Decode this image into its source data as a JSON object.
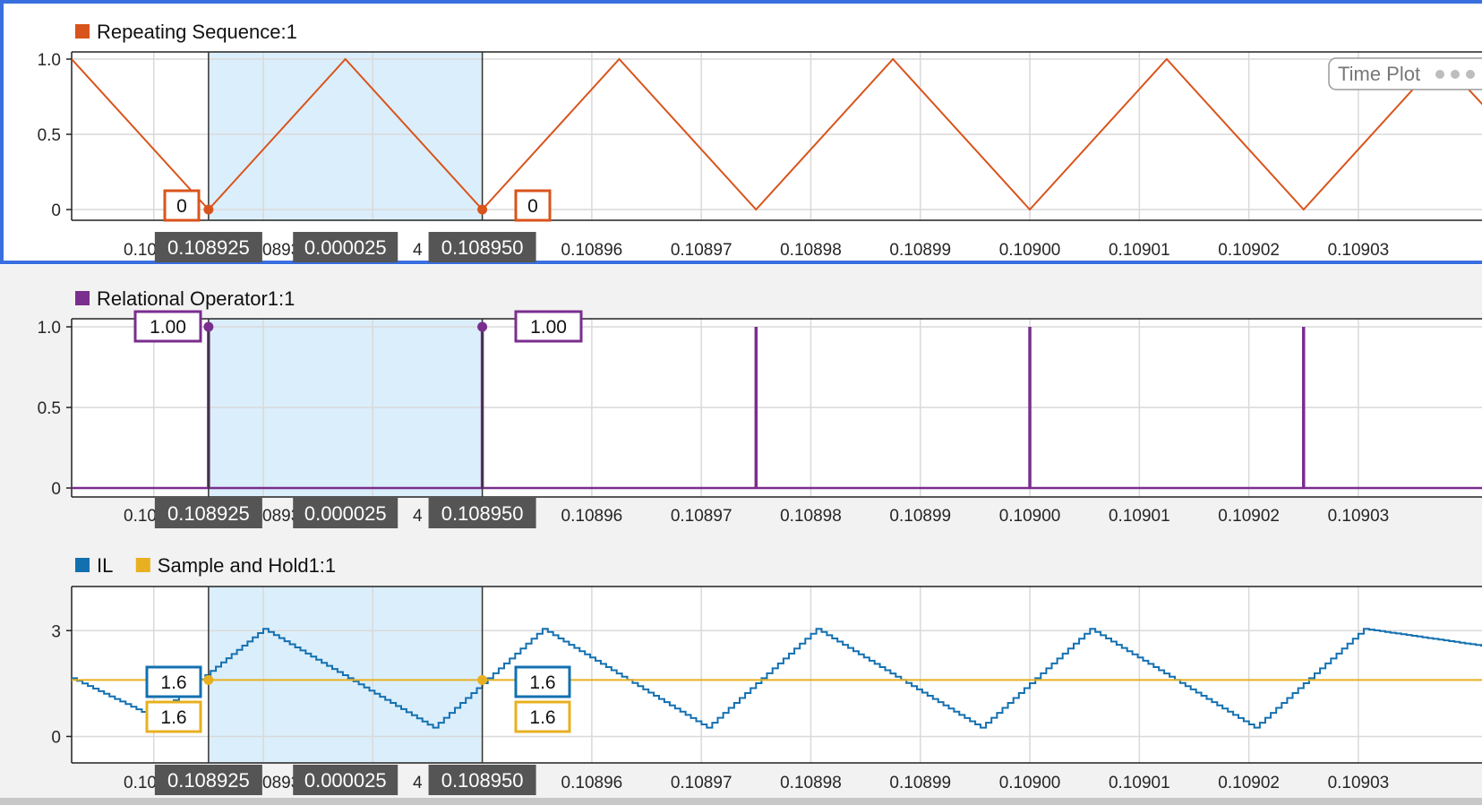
{
  "colors": {
    "repeating": "#d9541c",
    "relational": "#7a2e8e",
    "il": "#1370b0",
    "sample_hold": "#e8b020",
    "selection": "#dbeefb",
    "cursor_label_bg": "#555555",
    "active_border": "#3a6fe0",
    "grid": "#d9d9d9"
  },
  "badge": {
    "label": "Time Plot",
    "icon": "more-dots-icon"
  },
  "x_ticks": [
    "0.10895",
    "0.10896",
    "0.10897",
    "0.10898",
    "0.10899",
    "0.10900",
    "0.10901",
    "0.10902",
    "0.10903"
  ],
  "x_tick_values": [
    0.10895,
    0.10896,
    0.10897,
    0.10898,
    0.10899,
    0.109,
    0.10901,
    0.10902,
    0.10903
  ],
  "x_tick_partial": [
    "0.108",
    "0893",
    "4"
  ],
  "cursors": {
    "left": "0.108925",
    "delta": "0.000025",
    "right": "0.108950",
    "left_value": 0.108925,
    "right_value": 0.10895
  },
  "chart_data": [
    {
      "type": "line",
      "legend": [
        "Repeating Sequence:1"
      ],
      "y_ticks": [
        "1.0",
        "0.5",
        "0"
      ],
      "y_tick_values": [
        1.0,
        0.5,
        0
      ],
      "ylim": [
        0,
        1.0
      ],
      "xlim": [
        0.1089125,
        0.1090417
      ],
      "grid": true,
      "series": [
        {
          "name": "Repeating Sequence:1",
          "x": [
            0.1089125,
            0.108925,
            0.1089375,
            0.10895,
            0.1089625,
            0.108975,
            0.1089875,
            0.109,
            0.1090125,
            0.109025,
            0.1090375,
            0.1090417
          ],
          "y": [
            1.0,
            0,
            1.0,
            0,
            1.0,
            0,
            1.0,
            0,
            1.0,
            0,
            1.0,
            0.67
          ]
        }
      ],
      "cursor_values": [
        "0",
        "0"
      ]
    },
    {
      "type": "line",
      "legend": [
        "Relational Operator1:1"
      ],
      "y_ticks": [
        "1.0",
        "0.5",
        "0"
      ],
      "y_tick_values": [
        1.0,
        0.5,
        0
      ],
      "ylim": [
        0,
        1.0
      ],
      "xlim": [
        0.1089125,
        0.1090417
      ],
      "grid": true,
      "series": [
        {
          "name": "Relational Operator1:1",
          "pulses_at": [
            0.108925,
            0.10895,
            0.108975,
            0.109,
            0.109025
          ],
          "low": 0,
          "high": 1.0
        }
      ],
      "cursor_values": [
        "1.00",
        "1.00"
      ]
    },
    {
      "type": "line",
      "legend": [
        "IL",
        "Sample and Hold1:1"
      ],
      "y_ticks": [
        "3",
        "0"
      ],
      "y_tick_values": [
        3,
        0
      ],
      "ylim": [
        -0.75,
        4.25
      ],
      "xlim": [
        0.1089125,
        0.1090417
      ],
      "grid": true,
      "series": [
        {
          "name": "IL",
          "x": [
            0.1089125,
            0.1089199,
            0.10893,
            0.1089455,
            0.1089555,
            0.1089705,
            0.1089805,
            0.1089955,
            0.1090055,
            0.1090205,
            0.1090305,
            0.1090417
          ],
          "y": [
            1.65,
            0.55,
            3.05,
            0.25,
            3.05,
            0.25,
            3.05,
            0.25,
            3.05,
            0.25,
            3.05,
            2.55
          ]
        },
        {
          "name": "Sample and Hold1:1",
          "x": [
            0.1089125,
            0.1090417
          ],
          "y": [
            1.6,
            1.6
          ]
        }
      ],
      "cursor_values": [
        [
          "1.6",
          "1.6"
        ],
        [
          "1.6",
          "1.6"
        ]
      ]
    }
  ]
}
